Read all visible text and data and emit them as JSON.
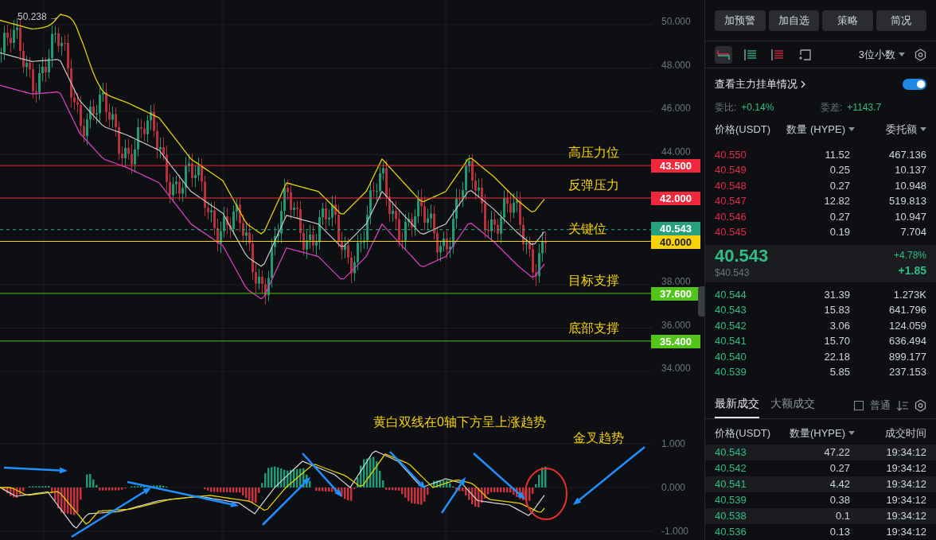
{
  "chart": {
    "high_marker": "50.238 →",
    "price_ticks": [
      "50.000",
      "48.000",
      "46.000",
      "44.000",
      "38.000",
      "36.000",
      "34.000"
    ],
    "levels": [
      {
        "label": "高压力位",
        "price": "43.500",
        "color": "#f0283c"
      },
      {
        "label": "反弹压力",
        "price": "42.000",
        "color": "#f0283c"
      },
      {
        "label": "关键位",
        "price": "40.000",
        "color": "#f5d20a"
      },
      {
        "label": "目标支撑",
        "price": "37.600",
        "color": "#52c41a"
      },
      {
        "label": "底部支撑",
        "price": "35.400",
        "color": "#52c41a"
      }
    ],
    "current_price": "40.543",
    "macd_ticks": [
      "1.000",
      "0.000",
      "-1.000"
    ],
    "annotations": [
      "黄白双线在0轴下方呈上涨趋势",
      "金叉趋势"
    ]
  },
  "actions": [
    "加预警",
    "加自选",
    "策略",
    "简况"
  ],
  "view_modes": [
    {
      "selected": true
    },
    {
      "selected": false
    },
    {
      "selected": false
    },
    {
      "selected": false
    }
  ],
  "precision": "3位小数",
  "depth_toggle": {
    "label": "查看主力挂单情况",
    "on": true
  },
  "stats": [
    {
      "label": "委比:",
      "value": "+0.14%"
    },
    {
      "label": "委差:",
      "value": "+1143.7"
    }
  ],
  "order_book": {
    "columns": [
      {
        "label": "价格(USDT)",
        "dropdown": false
      },
      {
        "label": "数量 (HYPE)",
        "dropdown": true
      },
      {
        "label": "委托额",
        "dropdown": true
      }
    ],
    "asks": [
      {
        "price": "40.550",
        "qty": "11.52",
        "amount": "467.136"
      },
      {
        "price": "40.549",
        "qty": "0.25",
        "amount": "10.137"
      },
      {
        "price": "40.548",
        "qty": "0.27",
        "amount": "10.948"
      },
      {
        "price": "40.547",
        "qty": "12.82",
        "amount": "519.813"
      },
      {
        "price": "40.546",
        "qty": "0.27",
        "amount": "10.947"
      },
      {
        "price": "40.545",
        "qty": "0.19",
        "amount": "7.704"
      }
    ],
    "last": {
      "price": "40.543",
      "usd": "$40.543",
      "change_pct": "+4.78%",
      "change": "+1.85"
    },
    "bids": [
      {
        "price": "40.544",
        "qty": "31.39",
        "amount": "1.273K"
      },
      {
        "price": "40.543",
        "qty": "15.83",
        "amount": "641.796"
      },
      {
        "price": "40.542",
        "qty": "3.06",
        "amount": "124.059"
      },
      {
        "price": "40.541",
        "qty": "15.70",
        "amount": "636.494"
      },
      {
        "price": "40.540",
        "qty": "22.18",
        "amount": "899.177"
      },
      {
        "price": "40.539",
        "qty": "5.85",
        "amount": "237.153"
      }
    ]
  },
  "trades": {
    "tabs": [
      {
        "label": "最新成交",
        "selected": true
      },
      {
        "label": "大额成交",
        "selected": false
      }
    ],
    "filter": {
      "label": "普通",
      "checked": false
    },
    "columns": [
      {
        "label": "价格(USDT)",
        "dropdown": false
      },
      {
        "label": "数量(HYPE)",
        "dropdown": true
      },
      {
        "label": "成交时间",
        "dropdown": false
      }
    ],
    "rows": [
      {
        "price": "40.543",
        "qty": "47.22",
        "time": "19:34:12"
      },
      {
        "price": "40.542",
        "qty": "0.27",
        "time": "19:34:12"
      },
      {
        "price": "40.541",
        "qty": "4.42",
        "time": "19:34:12"
      },
      {
        "price": "40.539",
        "qty": "0.38",
        "time": "19:34:12"
      },
      {
        "price": "40.538",
        "qty": "0.1",
        "time": "19:34:12"
      },
      {
        "price": "40.536",
        "qty": "0.13",
        "time": "19:34:12"
      }
    ]
  }
}
